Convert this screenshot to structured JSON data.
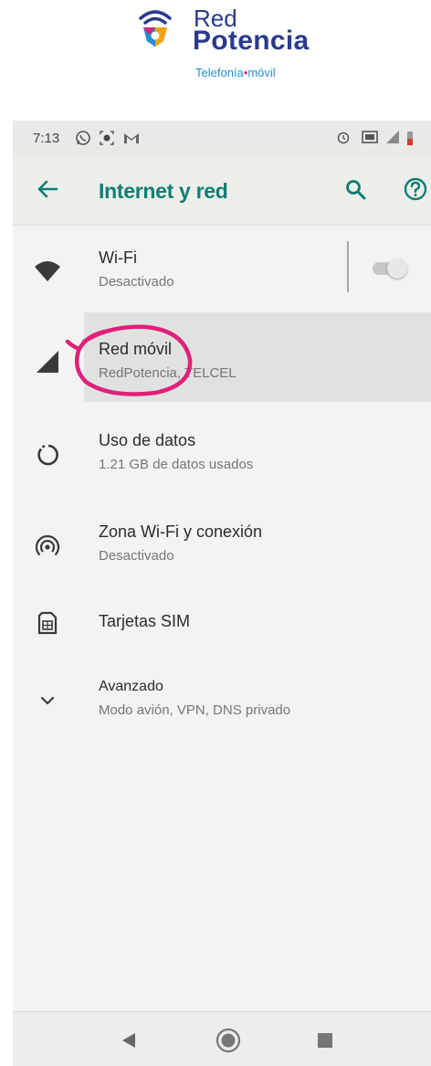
{
  "logo": {
    "line1": "Red",
    "line2": "Potencia",
    "tagline_part1": "Telefonía",
    "tagline_sep": "•",
    "tagline_part2": "móvil"
  },
  "statusbar": {
    "time": "7:13",
    "left_icons": [
      "whatsapp-icon",
      "record-icon",
      "gmail-icon"
    ],
    "right_icons": [
      "alarm-icon",
      "cast-icon",
      "signal-icon",
      "battery-icon"
    ]
  },
  "appbar": {
    "title": "Internet y red",
    "icons": [
      "back-arrow-icon",
      "search-icon",
      "help-icon"
    ]
  },
  "items": [
    {
      "name": "Wi-Fi",
      "summary": "Desactivado",
      "icon": "wifi-icon",
      "toggle": "off"
    },
    {
      "name": "Red móvil",
      "summary": "RedPotencia, TELCEL",
      "icon": "signal-icon"
    },
    {
      "name": "Uso de datos",
      "summary": "1.21 GB de datos usados",
      "icon": "data-usage-icon"
    },
    {
      "name": "Zona Wi-Fi y conexión",
      "summary": "Desactivado",
      "icon": "hotspot-icon"
    },
    {
      "name": "Tarjetas SIM",
      "summary": "",
      "icon": "sim-card-icon"
    },
    {
      "name": "Avanzado",
      "summary": "Modo avión, VPN, DNS privado",
      "icon": "expand-icon"
    }
  ],
  "colors": {
    "accent": "#0f7e72",
    "brand_blue": "#2a3a8c",
    "brand_light_blue": "#1f8fd6",
    "annotation": "#e0207a"
  },
  "navbar": {
    "icons": [
      "nav-back-icon",
      "nav-home-icon",
      "nav-recents-icon"
    ]
  }
}
